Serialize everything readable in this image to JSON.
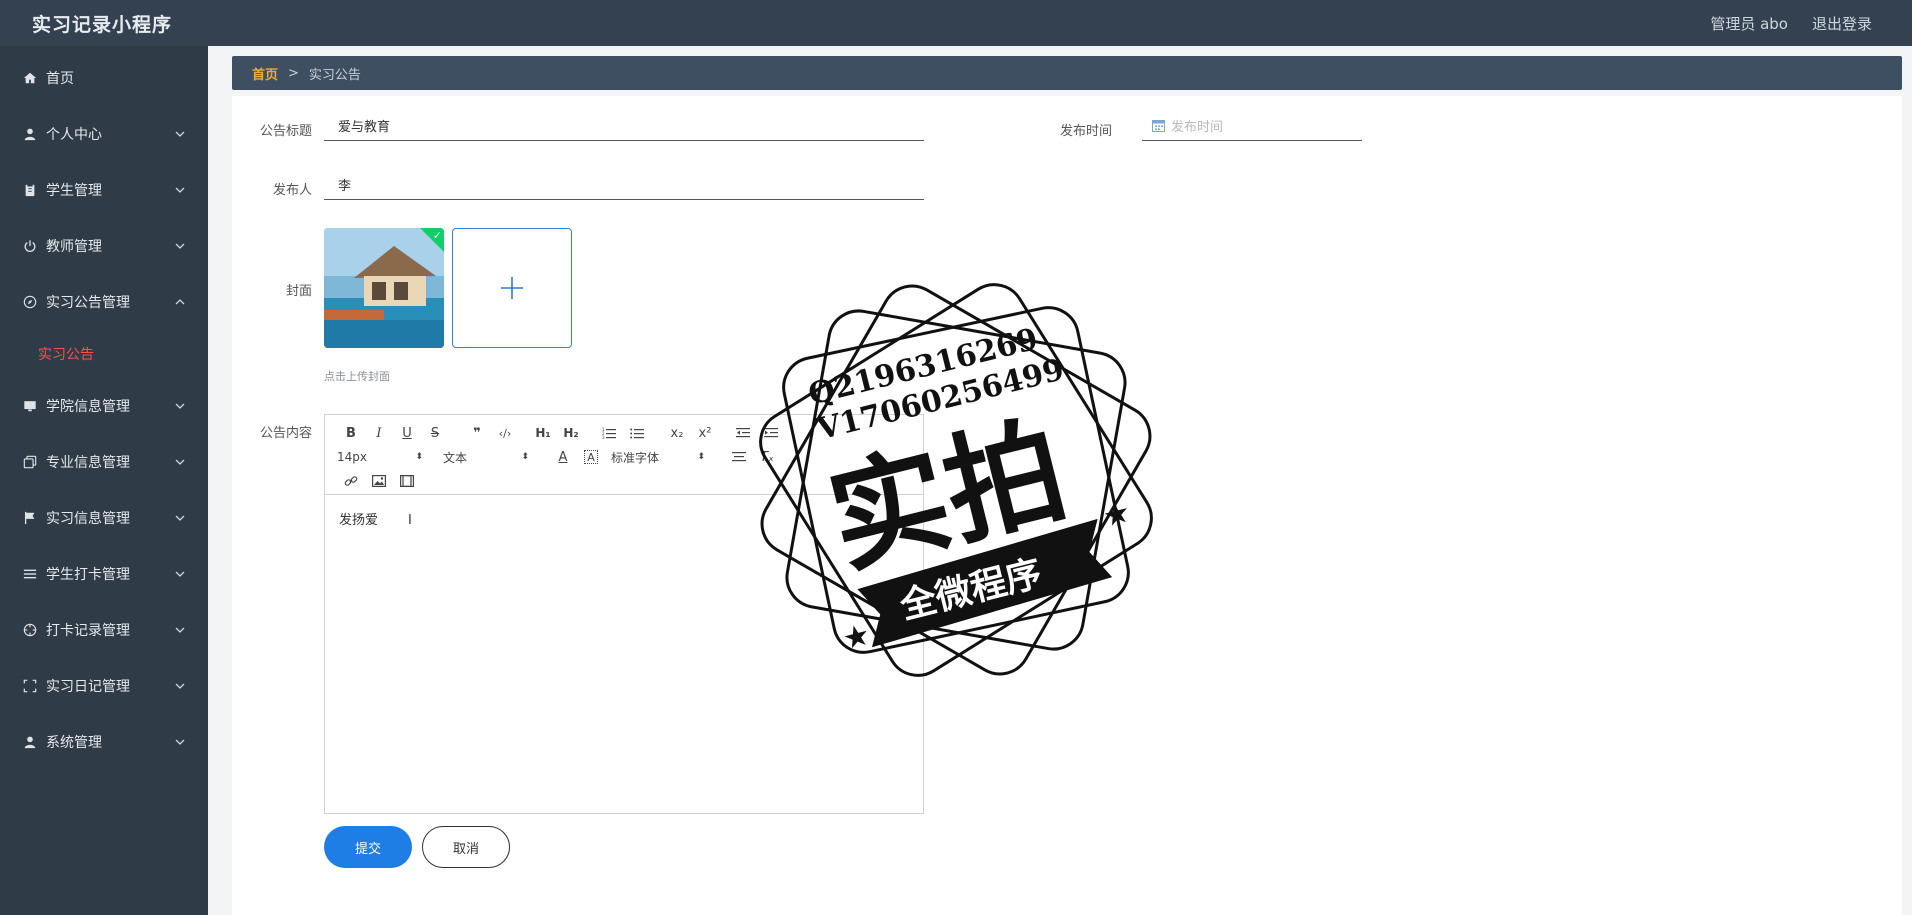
{
  "app": {
    "title": "实习记录小程序"
  },
  "topbar": {
    "admin_label": "管理员 abo",
    "logout_label": "退出登录"
  },
  "sidebar": {
    "items": [
      {
        "label": "首页",
        "icon": "home-icon"
      },
      {
        "label": "个人中心",
        "icon": "user-icon"
      },
      {
        "label": "学生管理",
        "icon": "clipboard-icon"
      },
      {
        "label": "教师管理",
        "icon": "power-icon"
      },
      {
        "label": "实习公告管理",
        "icon": "compass-icon"
      },
      {
        "label": "学院信息管理",
        "icon": "monitor-icon"
      },
      {
        "label": "专业信息管理",
        "icon": "copy-icon"
      },
      {
        "label": "实习信息管理",
        "icon": "flag-icon"
      },
      {
        "label": "学生打卡管理",
        "icon": "list-icon"
      },
      {
        "label": "打卡记录管理",
        "icon": "target-icon"
      },
      {
        "label": "实习日记管理",
        "icon": "frame-icon"
      },
      {
        "label": "系统管理",
        "icon": "user-icon"
      }
    ],
    "active_sub": "实习公告"
  },
  "breadcrumb": {
    "home": "首页",
    "separator": ">",
    "current": "实习公告"
  },
  "form": {
    "title_label": "公告标题",
    "title_value": "爱与教育",
    "publish_time_label": "发布时间",
    "publish_time_placeholder": "发布时间",
    "publisher_label": "发布人",
    "publisher_value": "李",
    "cover_label": "封面",
    "cover_hint": "点击上传封面",
    "content_label": "公告内容",
    "content_value": "发扬爱",
    "submit_label": "提交",
    "cancel_label": "取消"
  },
  "editor": {
    "font_size": "14px",
    "text_style": "文本",
    "font_family": "标准字体"
  },
  "watermark": {
    "line1": "Q2196316269",
    "line2": "V17060256499",
    "main": "实拍",
    "banner": "全微程序"
  },
  "colors": {
    "topbar": "#344150",
    "sidebar": "#2f3b47",
    "accent": "#1e7ee6",
    "active": "#ff4d4f",
    "breadcrumb_home": "#f0a93b"
  }
}
